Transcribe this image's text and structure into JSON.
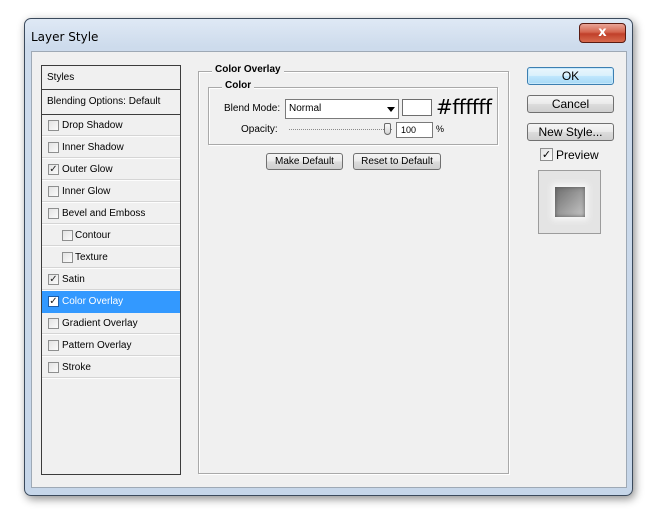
{
  "window": {
    "title": "Layer Style",
    "close_glyph": "x"
  },
  "styles_list": {
    "header": "Styles",
    "blending_options": "Blending Options: Default",
    "items": [
      {
        "label": "Drop Shadow",
        "checked": false
      },
      {
        "label": "Inner Shadow",
        "checked": false
      },
      {
        "label": "Outer Glow",
        "checked": true
      },
      {
        "label": "Inner Glow",
        "checked": false
      },
      {
        "label": "Bevel and Emboss",
        "checked": false
      },
      {
        "label": "Contour",
        "checked": false,
        "indented": true
      },
      {
        "label": "Texture",
        "checked": false,
        "indented": true
      },
      {
        "label": "Satin",
        "checked": true
      },
      {
        "label": "Color Overlay",
        "checked": true,
        "selected": true
      },
      {
        "label": "Gradient Overlay",
        "checked": false
      },
      {
        "label": "Pattern Overlay",
        "checked": false
      },
      {
        "label": "Stroke",
        "checked": false
      }
    ]
  },
  "color_overlay": {
    "group_title": "Color Overlay",
    "sub_title": "Color",
    "blend_mode_label": "Blend Mode:",
    "blend_mode_value": "Normal",
    "color_hex": "#ffffff",
    "hex_display": "#ffffff",
    "opacity_label": "Opacity:",
    "opacity_value": "100",
    "opacity_unit": "%",
    "make_default": "Make Default",
    "reset_default": "Reset to Default"
  },
  "actions": {
    "ok": "OK",
    "cancel": "Cancel",
    "new_style": "New Style...",
    "preview_label": "Preview",
    "preview_checked": true
  },
  "check_glyph": "✓",
  "colors": {
    "selection": "#3399ff",
    "dialog_bg": "#f0f0f0",
    "close_button": "#c0402a"
  }
}
